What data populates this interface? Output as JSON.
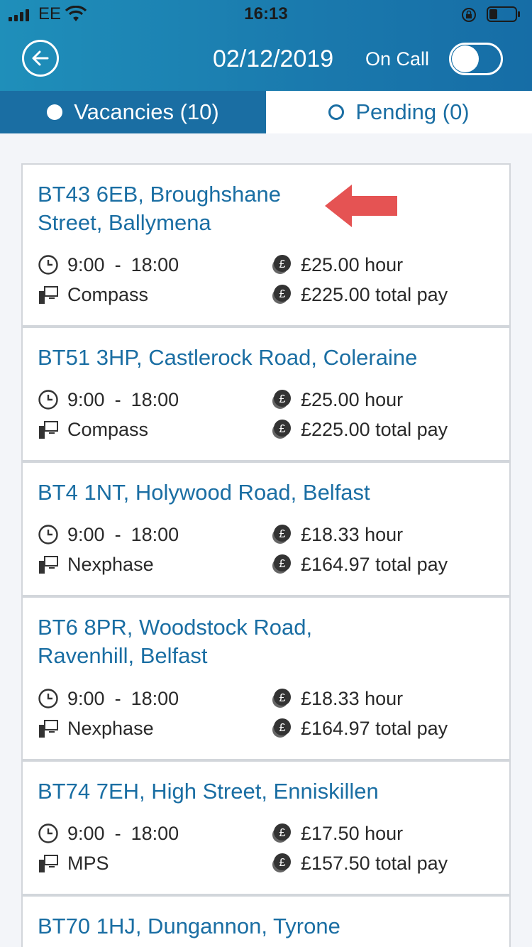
{
  "status_bar": {
    "carrier": "EE",
    "time": "16:13"
  },
  "header": {
    "date": "02/12/2019",
    "on_call_label": "On Call",
    "on_call_enabled": false
  },
  "tabs": [
    {
      "label": "Vacancies (10)",
      "active": true
    },
    {
      "label": "Pending (0)",
      "active": false
    }
  ],
  "vacancies": [
    {
      "title": "BT43 6EB, Broughshane Street, Ballymena",
      "start": "9:00",
      "end": "18:00",
      "rate": "£25.00 hour",
      "system": "Compass",
      "total": "£225.00 total pay"
    },
    {
      "title": "BT51 3HP, Castlerock Road, Coleraine",
      "start": "9:00",
      "end": "18:00",
      "rate": "£25.00 hour",
      "system": "Compass",
      "total": "£225.00 total pay"
    },
    {
      "title": "BT4 1NT, Holywood Road, Belfast",
      "start": "9:00",
      "end": "18:00",
      "rate": "£18.33 hour",
      "system": "Nexphase",
      "total": "£164.97 total pay"
    },
    {
      "title": "BT6 8PR, Woodstock Road, Ravenhill, Belfast",
      "start": "9:00",
      "end": "18:00",
      "rate": "£18.33 hour",
      "system": "Nexphase",
      "total": "£164.97 total pay"
    },
    {
      "title": "BT74 7EH, High Street, Enniskillen",
      "start": "9:00",
      "end": "18:00",
      "rate": "£17.50 hour",
      "system": "MPS",
      "total": "£157.50 total pay"
    },
    {
      "title": "BT70 1HJ, Dungannon, Tyrone"
    }
  ],
  "time_separator": "-",
  "colors": {
    "header": "#1a79ad",
    "accent": "#1a6ea3",
    "annotation_arrow": "#e55353"
  }
}
